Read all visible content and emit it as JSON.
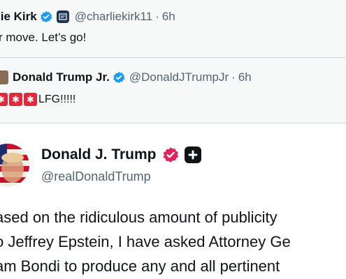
{
  "quoted_tweet": {
    "author_name": "lie Kirk",
    "handle": "@charliekirk11",
    "separator": "·",
    "time": "6h",
    "text": "r move. Let’s go!"
  },
  "nested_quote": {
    "author_name": "Donald Trump Jr.",
    "handle": "@DonaldJTrumpJr",
    "separator": "·",
    "time": "6h",
    "text": "LFG!!!!!"
  },
  "main_post": {
    "author_name": "Donald J. Trump",
    "handle": "@realDonaldTrump",
    "body_lines": [
      "ased on the ridiculous amount of publicity",
      "o Jeffrey Epstein, I have asked Attorney Ge",
      "am Bondi to produce any and all pertinent"
    ]
  },
  "colors": {
    "verified_blue": "#1d9bf0",
    "gold_badge": "#e0245e",
    "siren_red": "#e0293b",
    "secondary_text": "#536471"
  },
  "icons": {
    "verified": "verified-badge-icon",
    "gold": "gold-verified-badge-icon",
    "plus": "plus-badge-icon",
    "siren": "police-siren-emoji-icon"
  }
}
